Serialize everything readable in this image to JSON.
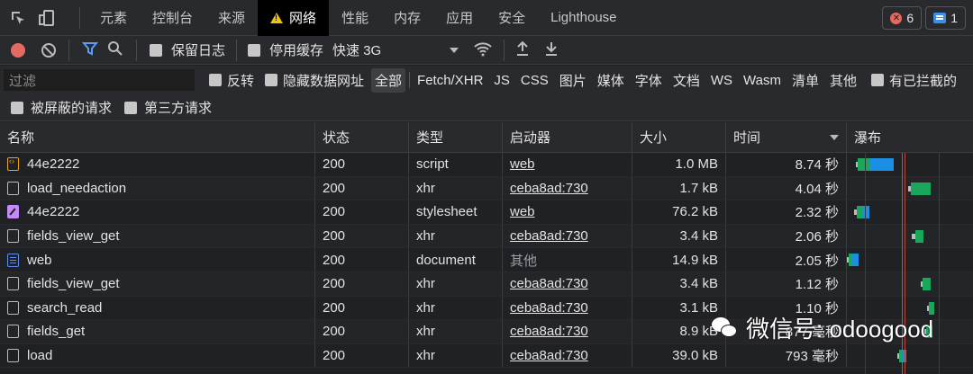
{
  "tabs": [
    {
      "label": "元素",
      "active": false
    },
    {
      "label": "控制台",
      "active": false
    },
    {
      "label": "来源",
      "active": false
    },
    {
      "label": "网络",
      "active": true
    },
    {
      "label": "性能",
      "active": false
    },
    {
      "label": "内存",
      "active": false
    },
    {
      "label": "应用",
      "active": false
    },
    {
      "label": "安全",
      "active": false
    },
    {
      "label": "Lighthouse",
      "active": false
    }
  ],
  "badges": {
    "errors": "6",
    "messages": "1"
  },
  "toolbar": {
    "preserve_log": "保留日志",
    "disable_cache": "停用缓存",
    "throttle": "快速 3G"
  },
  "filter": {
    "placeholder": "过滤",
    "invert": "反转",
    "hide_data_urls": "隐藏数据网址",
    "types": [
      "全部",
      "Fetch/XHR",
      "JS",
      "CSS",
      "图片",
      "媒体",
      "字体",
      "文档",
      "WS",
      "Wasm",
      "清单",
      "其他"
    ],
    "has_blocked_cookies": "有已拦截的",
    "blocked_requests": "被屏蔽的请求",
    "third_party": "第三方请求"
  },
  "columns": {
    "name": "名称",
    "status": "状态",
    "type": "类型",
    "initiator": "启动器",
    "size": "大小",
    "time": "时间",
    "waterfall": "瀑布"
  },
  "rows": [
    {
      "name": "44e2222",
      "icon": "script",
      "status": "200",
      "type": "script",
      "initiator": "web",
      "initiator_link": true,
      "size": "1.0 MB",
      "time": "8.74 秒"
    },
    {
      "name": "load_needaction",
      "icon": "xhr",
      "status": "200",
      "type": "xhr",
      "initiator": "ceba8ad:730",
      "initiator_link": true,
      "size": "1.7 kB",
      "time": "4.04 秒"
    },
    {
      "name": "44e2222",
      "icon": "stylesheet",
      "status": "200",
      "type": "stylesheet",
      "initiator": "web",
      "initiator_link": true,
      "size": "76.2 kB",
      "time": "2.32 秒"
    },
    {
      "name": "fields_view_get",
      "icon": "xhr",
      "status": "200",
      "type": "xhr",
      "initiator": "ceba8ad:730",
      "initiator_link": true,
      "size": "3.4 kB",
      "time": "2.06 秒"
    },
    {
      "name": "web",
      "icon": "document",
      "status": "200",
      "type": "document",
      "initiator": "其他",
      "initiator_link": false,
      "size": "14.9 kB",
      "time": "2.05 秒"
    },
    {
      "name": "fields_view_get",
      "icon": "xhr",
      "status": "200",
      "type": "xhr",
      "initiator": "ceba8ad:730",
      "initiator_link": true,
      "size": "3.4 kB",
      "time": "1.12 秒"
    },
    {
      "name": "search_read",
      "icon": "xhr",
      "status": "200",
      "type": "xhr",
      "initiator": "ceba8ad:730",
      "initiator_link": true,
      "size": "3.1 kB",
      "time": "1.10 秒"
    },
    {
      "name": "fields_get",
      "icon": "xhr",
      "status": "200",
      "type": "xhr",
      "initiator": "ceba8ad:730",
      "initiator_link": true,
      "size": "8.9 kB",
      "time": "877 毫秒"
    },
    {
      "name": "load",
      "icon": "xhr",
      "status": "200",
      "type": "xhr",
      "initiator": "ceba8ad:730",
      "initiator_link": true,
      "size": "39.0 kB",
      "time": "793 毫秒"
    }
  ],
  "watermark": "微信号: odoogood",
  "colors": {
    "waiting": "#19a75c",
    "download": "#1a8fe3",
    "record": "#e46962"
  }
}
